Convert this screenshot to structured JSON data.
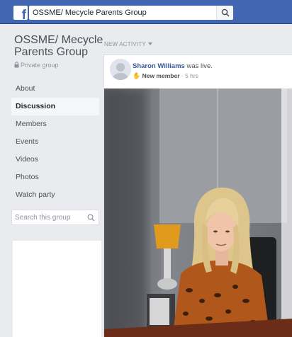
{
  "topbar": {
    "logo": "f",
    "search_value": "OSSME/ Mecycle Parents Group",
    "icons": {
      "search": "search-icon"
    }
  },
  "group": {
    "name": "OSSME/ Mecycle Parents Group",
    "privacy": "Private group",
    "privacy_icon": "lock-icon"
  },
  "nav": {
    "items": [
      {
        "label": "About",
        "active": false
      },
      {
        "label": "Discussion",
        "active": true
      },
      {
        "label": "Members",
        "active": false
      },
      {
        "label": "Events",
        "active": false
      },
      {
        "label": "Videos",
        "active": false
      },
      {
        "label": "Photos",
        "active": false
      },
      {
        "label": "Watch party",
        "active": false
      }
    ]
  },
  "group_search": {
    "placeholder": "Search this group"
  },
  "feed": {
    "section_label": "NEW ACTIVITY",
    "post": {
      "author": "Sharon Williams",
      "action": " was live.",
      "badge": "New member",
      "time": " · 5 hrs",
      "badge_icon": "wave-icon"
    }
  },
  "colors": {
    "brand": "#4267b2",
    "link": "#385898",
    "background": "#e9ebee"
  }
}
